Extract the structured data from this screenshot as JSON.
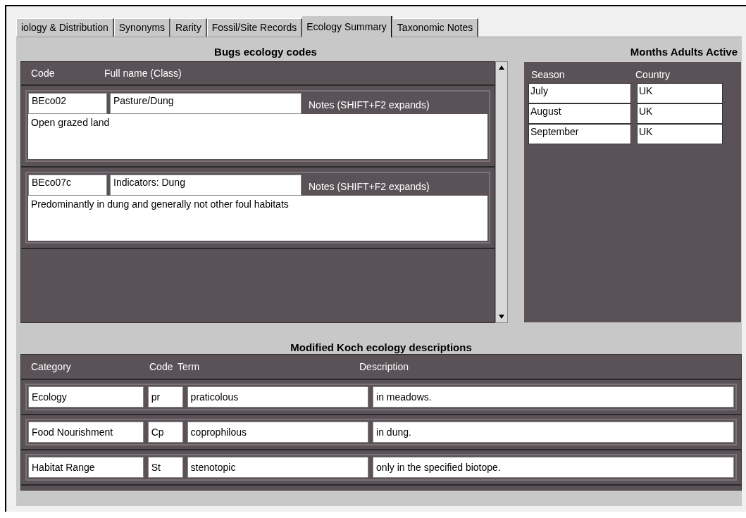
{
  "tabs": [
    {
      "label": "iology & Distribution",
      "selected": false
    },
    {
      "label": "Synonyms",
      "selected": false
    },
    {
      "label": "Rarity",
      "selected": false
    },
    {
      "label": "Fossil/Site Records",
      "selected": false
    },
    {
      "label": "Ecology Summary",
      "selected": true
    },
    {
      "label": "Taxonomic Notes",
      "selected": false
    }
  ],
  "ecology_codes": {
    "title": "Bugs ecology codes",
    "columns": [
      "Code",
      "Full name (Class)"
    ],
    "records": [
      {
        "code": "BEco02",
        "full_name": "Pasture/Dung",
        "notes_label": "Notes (SHIFT+F2 expands)",
        "notes": "Open grazed land"
      },
      {
        "code": "BEco07c",
        "full_name": "Indicators: Dung",
        "notes_label": "Notes (SHIFT+F2 expands)",
        "notes": "Predominantly in dung and generally not other foul habitats"
      }
    ]
  },
  "months_active": {
    "title": "Months Adults Active",
    "columns": [
      "Season",
      "Country"
    ],
    "rows": [
      [
        "July",
        "UK"
      ],
      [
        "August",
        "UK"
      ],
      [
        "September",
        "UK"
      ]
    ]
  },
  "koch": {
    "title": "Modified Koch ecology descriptions",
    "columns": [
      "Category",
      "Code",
      "Term",
      "Description"
    ],
    "rows": [
      [
        "Ecology",
        "pr",
        "praticolous",
        "in meadows."
      ],
      [
        "Food Nourishment",
        "Cp",
        "coprophilous",
        "in dung."
      ],
      [
        "Habitat Range",
        "St",
        "stenotopic",
        "only in the specified biotope."
      ]
    ]
  }
}
